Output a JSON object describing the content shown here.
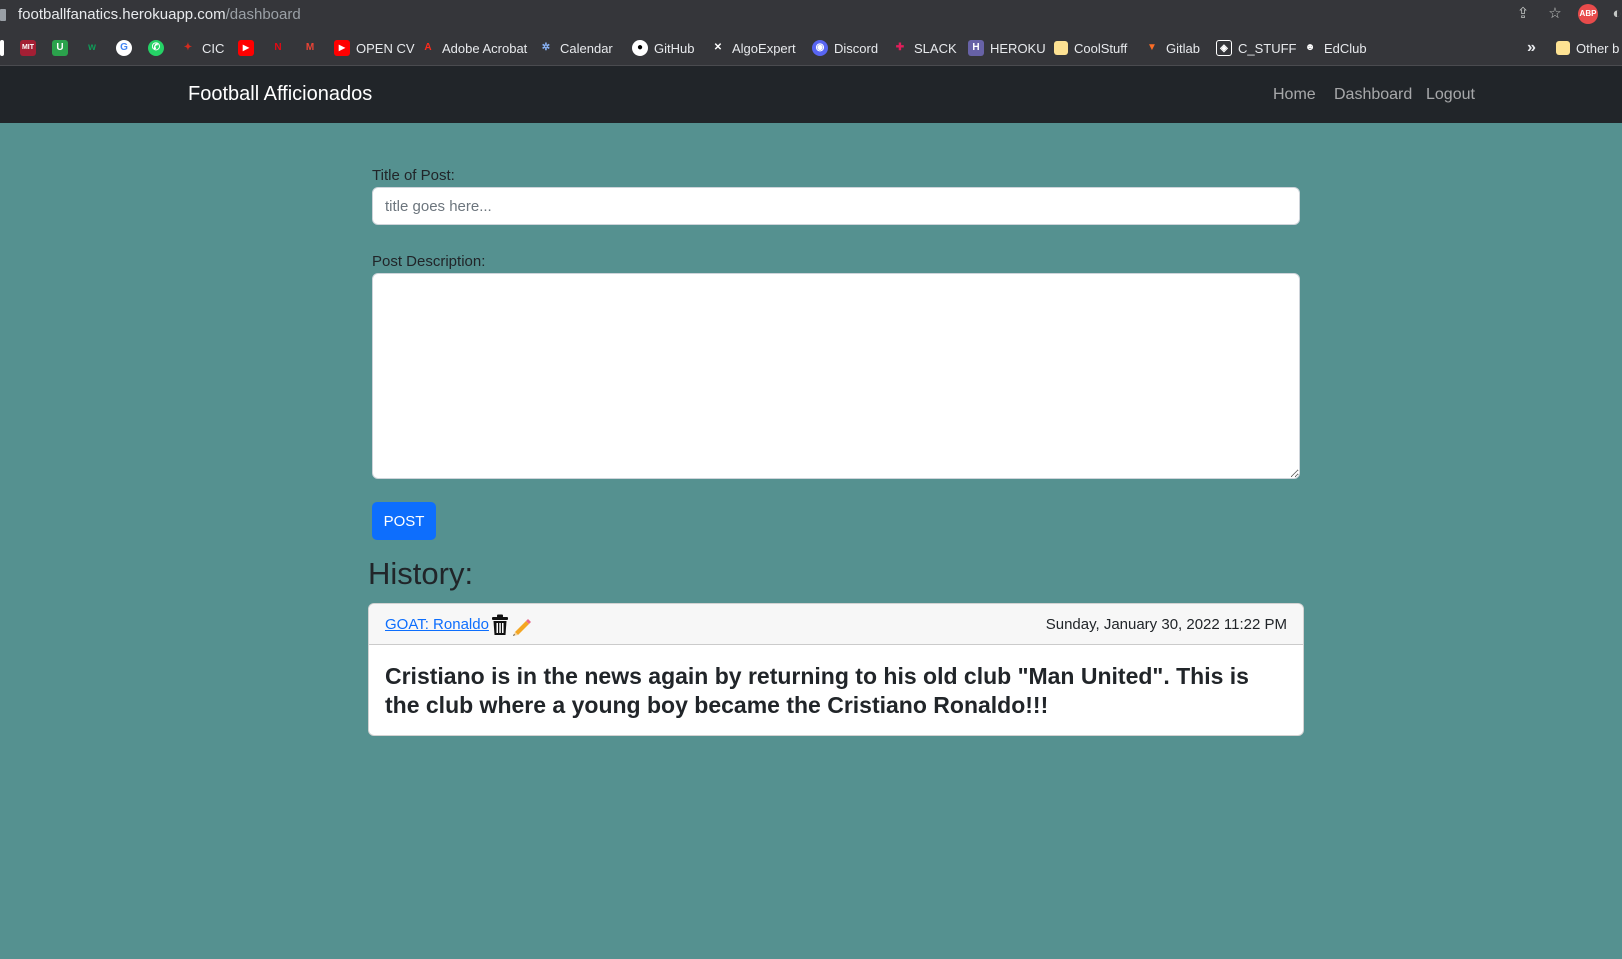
{
  "browser": {
    "url_host": "footballfanatics.herokuapp.com",
    "url_path": "/dashboard",
    "abp_label": "ABP",
    "bookmarks": [
      {
        "label": "",
        "icon": "mit-icon"
      },
      {
        "label": "",
        "icon": "u-icon"
      },
      {
        "label": "",
        "icon": "w-icon"
      },
      {
        "label": "",
        "icon": "google-icon"
      },
      {
        "label": "",
        "icon": "whatsapp-icon"
      },
      {
        "label": "CIC",
        "icon": "maple-leaf-icon"
      },
      {
        "label": "",
        "icon": "youtube-icon"
      },
      {
        "label": "",
        "icon": "netflix-icon"
      },
      {
        "label": "",
        "icon": "gmail-icon"
      },
      {
        "label": "OPEN CV",
        "icon": "youtube-icon"
      },
      {
        "label": "Adobe Acrobat",
        "icon": "acrobat-icon"
      },
      {
        "label": "Calendar",
        "icon": "calendar-icon"
      },
      {
        "label": "GitHub",
        "icon": "github-icon"
      },
      {
        "label": "AlgoExpert",
        "icon": "algoexpert-icon"
      },
      {
        "label": "Discord",
        "icon": "discord-icon"
      },
      {
        "label": "SLACK",
        "icon": "slack-icon"
      },
      {
        "label": "HEROKU",
        "icon": "heroku-icon"
      },
      {
        "label": "CoolStuff",
        "icon": "folder-icon"
      },
      {
        "label": "Gitlab",
        "icon": "gitlab-icon"
      },
      {
        "label": "C_STUFF",
        "icon": "cstuff-icon"
      },
      {
        "label": "EdClub",
        "icon": "edclub-icon"
      }
    ],
    "overflow_label": "»",
    "other_bookmarks_label": "Other b"
  },
  "navbar": {
    "brand": "Football Afficionados",
    "links": [
      "Home",
      "Dashboard",
      "Logout"
    ]
  },
  "form": {
    "title_label": "Title of Post:",
    "title_placeholder": "title goes here...",
    "title_value": "",
    "description_label": "Post Description:",
    "description_value": "",
    "post_button": "POST"
  },
  "history": {
    "heading": "History:",
    "posts": [
      {
        "title": "GOAT: Ronaldo",
        "date": "Sunday, January 30, 2022 11:22 PM",
        "body": "Cristiano is in the news again by returning to his old club \"Man United\". This is the club where a young boy became the Cristiano Ronaldo!!!"
      }
    ]
  },
  "colors": {
    "page_bg": "#559190",
    "navbar_bg": "#212529",
    "primary": "#0d6efd"
  }
}
